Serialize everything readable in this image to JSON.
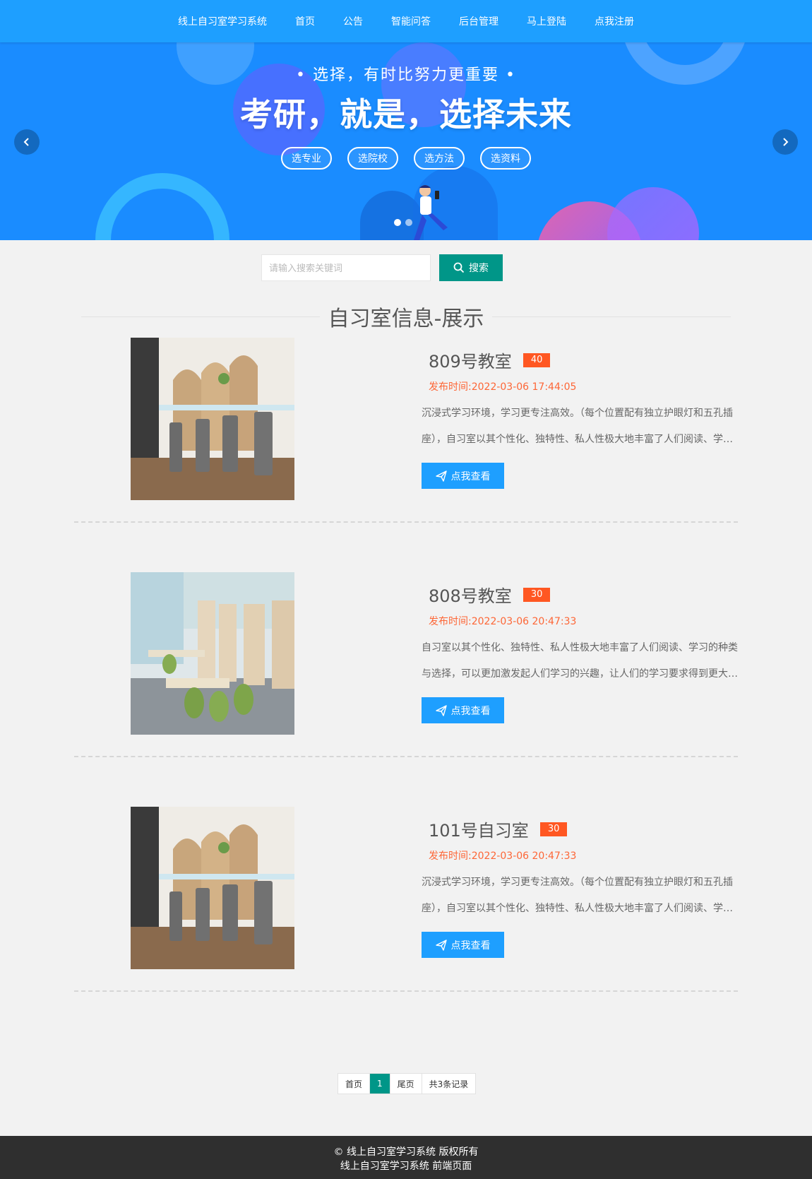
{
  "nav": {
    "brand": "线上自习室学习系统",
    "items": [
      "首页",
      "公告",
      "智能问答",
      "后台管理",
      "马上登陆",
      "点我注册"
    ]
  },
  "banner": {
    "slogan": "• 选择，有时比努力更重要 •",
    "headline": "考研，就是，选择未来",
    "pills": [
      "选专业",
      "选院校",
      "选方法",
      "选资料"
    ],
    "prev_icon": "chevron-left-icon",
    "next_icon": "chevron-right-icon",
    "slide_count": 2,
    "active_slide": 1
  },
  "search": {
    "placeholder": "请输入搜索关键词",
    "value": "",
    "button_label": "搜索",
    "button_icon": "search-icon"
  },
  "section": {
    "title": "自习室信息-展示"
  },
  "rooms": [
    {
      "name": "809号教室",
      "count": "40",
      "time": "发布时间:2022-03-06 17:44:05",
      "desc": "沉浸式学习环境，学习更专注高效。（每个位置配有独立护眼灯和五孔插座），自习室以其个性化、独特性、私人性极大地丰富了人们阅读、学习的种类与选择，可以更加激发起人们学习的兴趣",
      "button": "点我查看",
      "image": "study-room-photo"
    },
    {
      "name": "808号教室",
      "count": "30",
      "time": "发布时间:2022-03-06 20:47:33",
      "desc": "自习室以其个性化、独特性、私人性极大地丰富了人们阅读、学习的种类与选择，可以更加激发起人们学习的兴趣，让人们的学习要求得到更大的满足",
      "button": "点我查看",
      "image": "study-room-photo"
    },
    {
      "name": "101号自习室",
      "count": "30",
      "time": "发布时间:2022-03-06 20:47:33",
      "desc": "沉浸式学习环境，学习更专注高效。（每个位置配有独立护眼灯和五孔插座），自习室以其个性化、独特性、私人性极大地丰富了人们阅读、学习的种类与选择，可以更加激发起人们学习的兴趣",
      "button": "点我查看",
      "image": "study-room-photo"
    }
  ],
  "pager": {
    "first": "首页",
    "current": "1",
    "last": "尾页",
    "total": "共3条记录"
  },
  "footer": {
    "line1": "© 线上自习室学习系统 版权所有",
    "line2": "线上自习室学习系统 前端页面"
  },
  "colors": {
    "nav": "#1e9fff",
    "banner": "#1a8cff",
    "search_button": "#009688",
    "badge": "#ff5722",
    "view_button": "#1e9fff",
    "footer": "#2f2f2f"
  }
}
